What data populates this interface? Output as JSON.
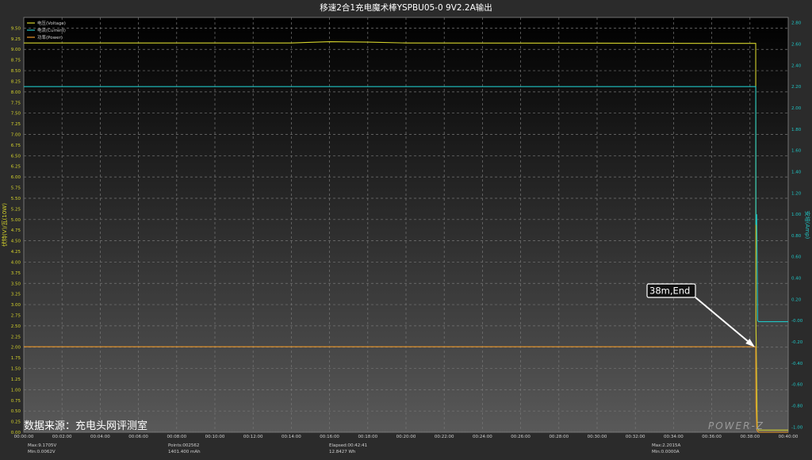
{
  "chart_data": {
    "type": "line",
    "title": "移速2合1充电魔术棒YSPBU05-0 9V2.2A输出",
    "y_left_label": "伏特(V)/瓦(10W)",
    "y_right_label": "安培(Amp)",
    "y_left_range": [
      0,
      9.75
    ],
    "y_right_range": [
      -1.05,
      2.85
    ],
    "y_left_ticks": [
      "0.00",
      "0.25",
      "0.50",
      "0.75",
      "1.00",
      "1.25",
      "1.50",
      "1.75",
      "2.00",
      "2.25",
      "2.50",
      "2.75",
      "3.00",
      "3.25",
      "3.50",
      "3.75",
      "4.00",
      "4.25",
      "4.50",
      "4.75",
      "5.00",
      "5.25",
      "5.50",
      "5.75",
      "6.00",
      "6.25",
      "6.50",
      "6.75",
      "7.00",
      "7.25",
      "7.50",
      "7.75",
      "8.00",
      "8.25",
      "8.50",
      "8.75",
      "9.00",
      "9.25",
      "9.50"
    ],
    "y_right_ticks": [
      "-1.00",
      "-0.80",
      "-0.60",
      "-0.40",
      "-0.20",
      "-0.00",
      "0.20",
      "0.40",
      "0.60",
      "0.80",
      "1.00",
      "1.20",
      "1.40",
      "1.60",
      "1.80",
      "2.00",
      "2.20",
      "2.40",
      "2.60",
      "2.80"
    ],
    "x_range_minutes": [
      0,
      40
    ],
    "x_ticks": [
      "00:00:00",
      "00:02:00",
      "00:04:00",
      "00:06:00",
      "00:08:00",
      "00:10:00",
      "00:12:00",
      "00:14:00",
      "00:16:00",
      "00:18:00",
      "00:20:00",
      "00:22:00",
      "00:24:00",
      "00:26:00",
      "00:28:00",
      "00:30:00",
      "00:32:00",
      "00:34:00",
      "00:36:00",
      "00:38:00",
      "00:40:00"
    ],
    "grid": true,
    "legend_position": "top-left",
    "series": [
      {
        "name": "电压(Voltage)",
        "color": "#d4d22c",
        "axis": "left",
        "x": [
          0,
          14,
          16,
          18,
          20,
          38.3,
          38.31,
          38.38,
          38.45,
          40
        ],
        "y": [
          9.15,
          9.15,
          9.18,
          9.17,
          9.15,
          9.14,
          2.6,
          0.12,
          0.05,
          0.05
        ]
      },
      {
        "name": "电流(Current)",
        "color": "#1fc4c4",
        "axis": "right",
        "x": [
          0,
          38.3,
          38.31,
          38.35,
          38.4,
          38.45,
          40
        ],
        "y": [
          2.2,
          2.2,
          0.9,
          1.0,
          0.0,
          -0.01,
          -0.01
        ]
      },
      {
        "name": "功率(Power)",
        "color": "#e8962a",
        "axis": "left",
        "x": [
          0,
          38.3,
          38.31,
          38.36,
          38.45,
          40
        ],
        "y": [
          2.01,
          2.01,
          0.7,
          0.05,
          0.0,
          0.0
        ]
      }
    ],
    "annotation": {
      "text": "38m,End"
    }
  },
  "watermark": "数据来源：充电头网评测室",
  "logo": "POWER-Z",
  "footer": {
    "max_v": "Max:9.1705V",
    "min_v": "Min:0.0062V",
    "points": "Points:002562",
    "mah": "1401.400 mAh",
    "elapsed": "Elapsed:00:42:41",
    "wh": "12.8427 Wh",
    "max_a": "Max:2.2015A",
    "min_a": "Min:0.0000A"
  }
}
